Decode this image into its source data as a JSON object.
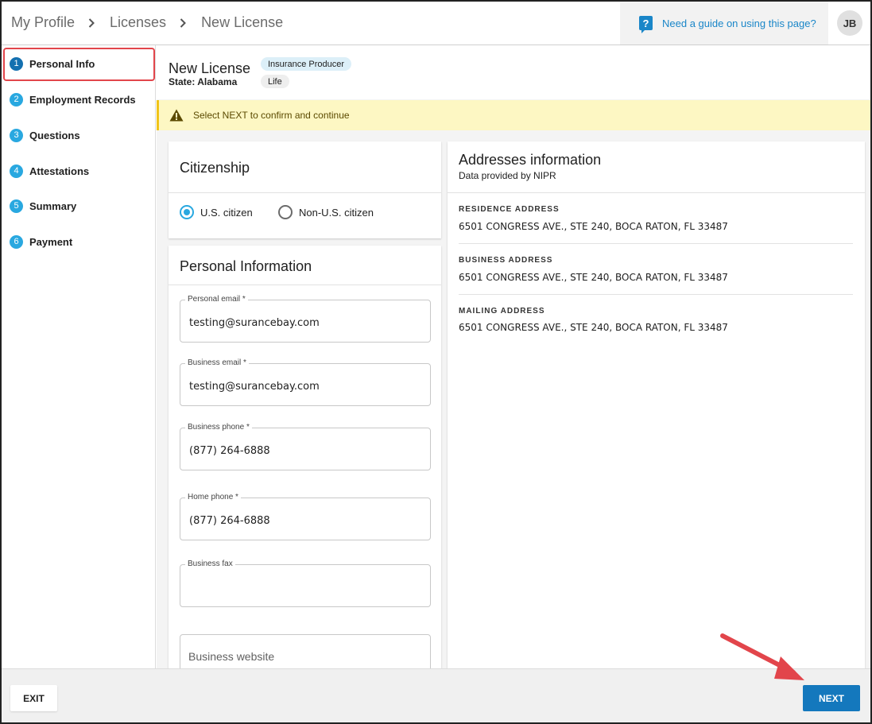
{
  "header": {
    "breadcrumbs": [
      "My Profile",
      "Licenses",
      "New License"
    ],
    "guide_text": "Need a guide on using this page?",
    "guide_icon": "question-help-icon",
    "avatar_initials": "JB"
  },
  "sidebar": {
    "steps": [
      {
        "num": "1",
        "label": "Personal Info",
        "active": true
      },
      {
        "num": "2",
        "label": "Employment Records",
        "active": false
      },
      {
        "num": "3",
        "label": "Questions",
        "active": false
      },
      {
        "num": "4",
        "label": "Attestations",
        "active": false
      },
      {
        "num": "5",
        "label": "Summary",
        "active": false
      },
      {
        "num": "6",
        "label": "Payment",
        "active": false
      }
    ],
    "highlight_color": "#e2454b"
  },
  "page": {
    "title": "New License",
    "state": "State: Alabama",
    "chips": [
      "Insurance Producer",
      "Life"
    ]
  },
  "banner": {
    "icon": "warning-icon",
    "text": "Select NEXT to confirm and continue",
    "color": "#fdf7c3"
  },
  "citizenship": {
    "title": "Citizenship",
    "options": [
      {
        "label": "U.S. citizen",
        "selected": true
      },
      {
        "label": "Non-U.S. citizen",
        "selected": false
      }
    ]
  },
  "personal_info": {
    "title": "Personal Information",
    "fields": [
      {
        "label": "Personal email *",
        "value": "testing@surancebay.com"
      },
      {
        "label": "Business email *",
        "value": "testing@surancebay.com"
      },
      {
        "label": "Business phone *",
        "value": "(877) 264-6888"
      },
      {
        "label": "Home phone *",
        "value": "(877) 264-6888"
      },
      {
        "label": "Business fax",
        "value": ""
      }
    ],
    "website_placeholder": "Business website"
  },
  "addresses": {
    "title": "Addresses information",
    "subtitle": "Data provided by NIPR",
    "items": [
      {
        "label": "RESIDENCE ADDRESS",
        "value": "6501 CONGRESS AVE., STE 240, BOCA RATON, FL 33487"
      },
      {
        "label": "BUSINESS ADDRESS",
        "value": "6501 CONGRESS AVE., STE 240, BOCA RATON, FL 33487"
      },
      {
        "label": "MAILING ADDRESS",
        "value": "6501 CONGRESS AVE., STE 240, BOCA RATON, FL 33487"
      }
    ]
  },
  "footer": {
    "exit_label": "EXIT",
    "next_label": "NEXT"
  },
  "colors": {
    "accent": "#1478bd",
    "step_blue": "#29a8e0",
    "annotation_red": "#e2454b"
  }
}
